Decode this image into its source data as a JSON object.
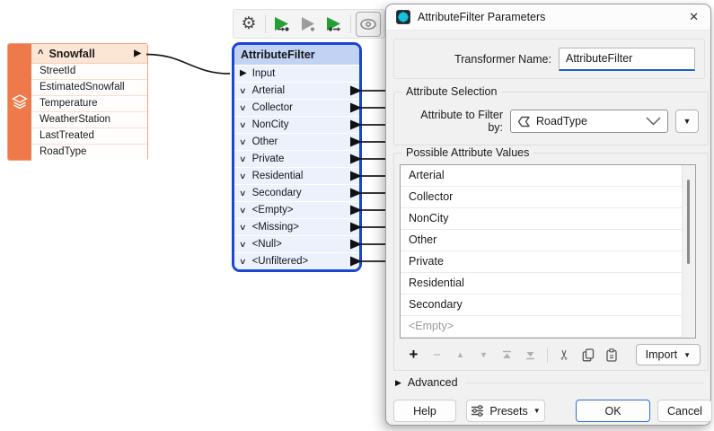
{
  "colors": {
    "node_orange": "#ee7a4c",
    "node_orange_header": "#fbe5d4",
    "selection_blue": "#1c45d0",
    "transformer_header": "#c2d2f2",
    "focus_underline": "#1f5fc4",
    "run_green": "#23a033"
  },
  "icons": {
    "collapse_caret": "^",
    "port_out_triangle": "▶",
    "port_in_triangle": "▶",
    "chevron_down": "∨",
    "gear": "⚙",
    "close": "✕",
    "dropdown_arrow": "▼",
    "advanced_triangle": "▶",
    "plus": "+",
    "minus": "−",
    "move_up": "▲",
    "move_down": "▼",
    "scissors": "✂"
  },
  "source_node": {
    "title": "Snowfall",
    "attributes": [
      "StreetId",
      "EstimatedSnowfall",
      "Temperature",
      "WeatherStation",
      "LastTreated",
      "RoadType"
    ]
  },
  "transformer_node": {
    "title": "AttributeFilter",
    "input_port": "Input",
    "output_ports": [
      "Arterial",
      "Collector",
      "NonCity",
      "Other",
      "Private",
      "Residential",
      "Secondary",
      "<Empty>",
      "<Missing>",
      "<Null>",
      "<Unfiltered>"
    ]
  },
  "dialog": {
    "title": "AttributeFilter Parameters",
    "transformer_name": {
      "label": "Transformer Name:",
      "value": "AttributeFilter"
    },
    "attribute_selection": {
      "group_label": "Attribute Selection",
      "field_label": "Attribute to Filter by:",
      "value": "RoadType"
    },
    "possible_values": {
      "group_label": "Possible Attribute Values",
      "items": [
        {
          "text": "Arterial",
          "muted": false
        },
        {
          "text": "Collector",
          "muted": false
        },
        {
          "text": "NonCity",
          "muted": false
        },
        {
          "text": "Other",
          "muted": false
        },
        {
          "text": "Private",
          "muted": false
        },
        {
          "text": "Residential",
          "muted": false
        },
        {
          "text": "Secondary",
          "muted": false
        },
        {
          "text": "<Empty>",
          "muted": true
        }
      ],
      "import_label": "Import"
    },
    "advanced_label": "Advanced",
    "buttons": {
      "help": "Help",
      "presets": "Presets",
      "ok": "OK",
      "cancel": "Cancel"
    }
  }
}
